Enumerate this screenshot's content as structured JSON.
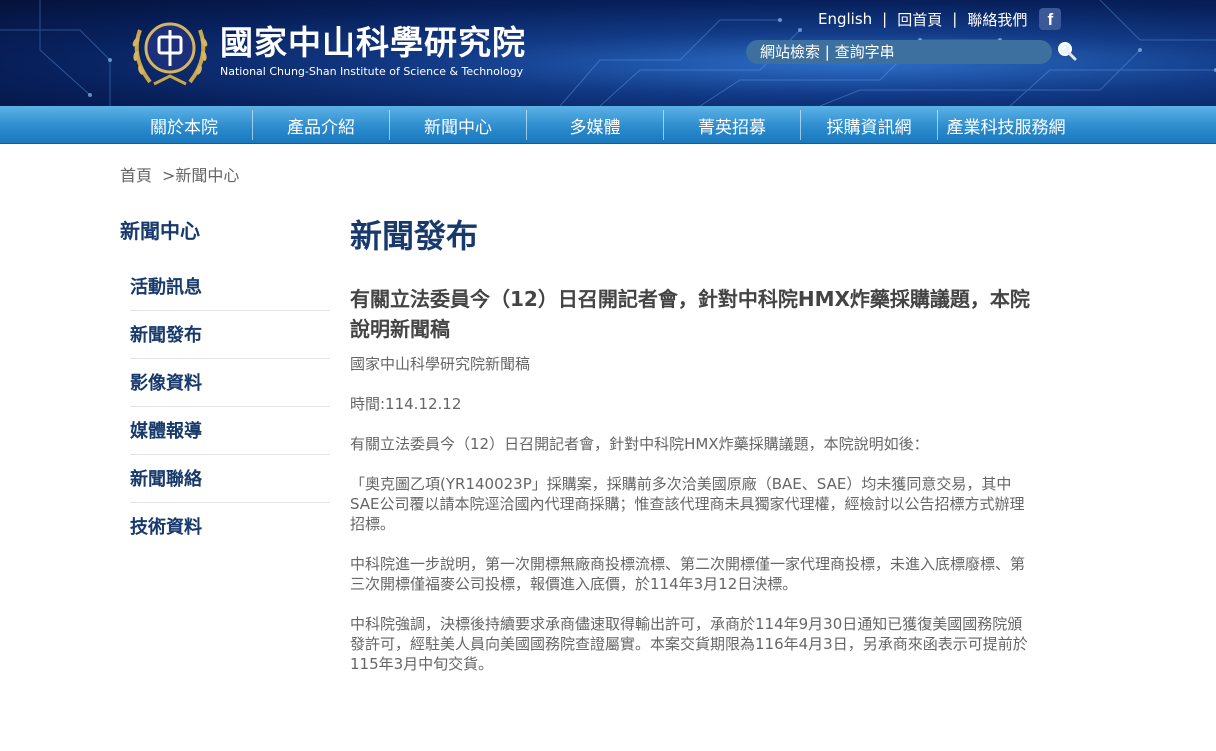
{
  "header": {
    "logo_zh": "國家中山科學研究院",
    "logo_en": "National Chung-Shan Institute of Science & Technology",
    "links": {
      "english": "English",
      "home": "回首頁",
      "contact": "聯絡我們"
    },
    "search_text": "網站檢索 | 查詢字串"
  },
  "nav": [
    "關於本院",
    "產品介紹",
    "新聞中心",
    "多媒體",
    "菁英招募",
    "採購資訊網",
    "產業科技服務網"
  ],
  "breadcrumb": {
    "home": "首頁",
    "current": ">新聞中心"
  },
  "sidebar": {
    "title": "新聞中心",
    "items": [
      "活動訊息",
      "新聞發布",
      "影像資料",
      "媒體報導",
      "新聞聯絡",
      "技術資料"
    ]
  },
  "main": {
    "page_title": "新聞發布",
    "article_title": "有關立法委員今（12）日召開記者會，針對中科院HMX炸藥採購議題，本院說明新聞稿",
    "source": "國家中山科學研究院新聞稿",
    "date": "時間:114.12.12",
    "paragraphs": [
      "有關立法委員今（12）日召開記者會，針對中科院HMX炸藥採購議題，本院說明如後：",
      "「奧克圖乙項(YR140023P」採購案，採購前多次洽美國原廠（BAE、SAE）均未獲同意交易，其中SAE公司覆以請本院逕洽國內代理商採購；惟查該代理商未具獨家代理權，經檢討以公告招標方式辦理招標。",
      "中科院進一步說明，第一次開標無廠商投標流標、第二次開標僅一家代理商投標，未進入底標廢標、第三次開標僅福麥公司投標，報價進入底價，於114年3月12日決標。",
      "中科院強調，決標後持續要求承商儘速取得輸出許可，承商於114年9月30日通知已獲復美國國務院頒發許可，經駐美人員向美國國務院查證屬實。本案交貨期限為116年4月3日，另承商來函表示可提前於115年3月中旬交貨。"
    ]
  },
  "colors": {
    "brand_navy": "#17396b",
    "nav_blue": "#2d8dcf",
    "facebook": "#3b5998"
  }
}
